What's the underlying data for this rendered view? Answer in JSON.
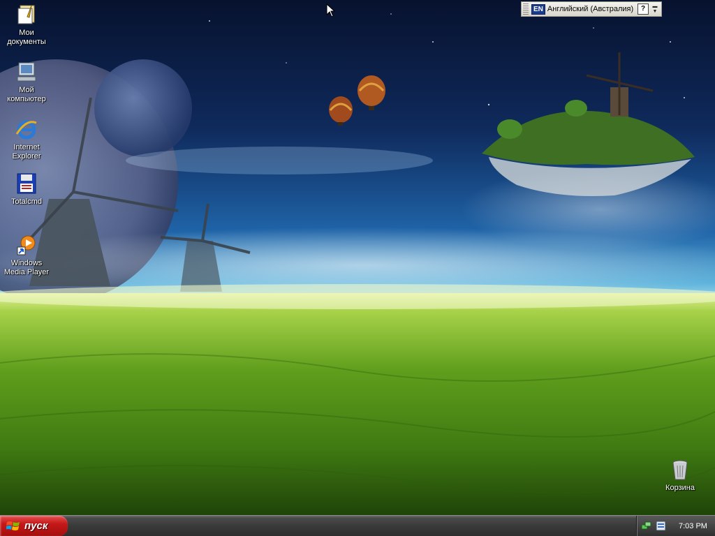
{
  "desktop": {
    "icons": [
      {
        "label": "Мои документы",
        "icon": "my-documents-icon"
      },
      {
        "label": "Мой компьютер",
        "icon": "my-computer-icon"
      },
      {
        "label": "Internet Explorer",
        "icon": "internet-explorer-icon"
      },
      {
        "label": "Totalcmd",
        "icon": "totalcmd-icon"
      },
      {
        "label": "Windows Media Player",
        "icon": "windows-media-player-icon"
      },
      {
        "label": "Корзина",
        "icon": "recycle-bin-icon"
      }
    ]
  },
  "language_bar": {
    "code": "EN",
    "language": "Английский (Австралия)",
    "help_glyph": "?"
  },
  "taskbar": {
    "start_label": "пуск",
    "clock": "7:03 PM",
    "tray_icons": [
      "network-icon",
      "volume-icon"
    ]
  },
  "colors": {
    "start_button": "#c51818",
    "taskbar": "#3a3a3a",
    "sky_top": "#0c1a3a",
    "grass": "#5e9e1e"
  }
}
